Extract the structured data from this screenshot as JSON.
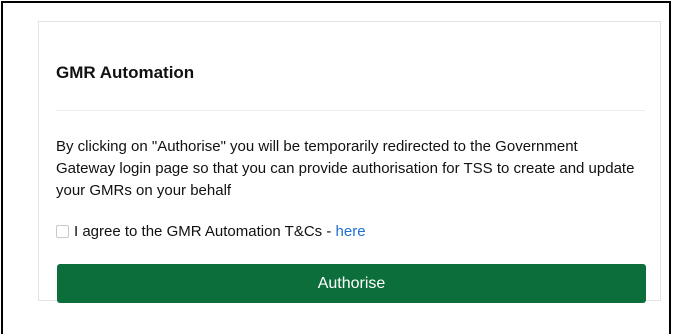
{
  "card": {
    "title": "GMR Automation",
    "description": "By clicking on \"Authorise\" you will be temporarily redirected to the Government Gateway login page so that you can provide authorisation for TSS to create and update your GMRs on your behalf",
    "agreement": {
      "checked": false,
      "label": "I agree to the GMR Automation T&Cs - ",
      "link_text": "here"
    },
    "authorise_label": "Authorise"
  },
  "colors": {
    "button_background": "#0b6e3b",
    "link": "#1d6fd1"
  }
}
